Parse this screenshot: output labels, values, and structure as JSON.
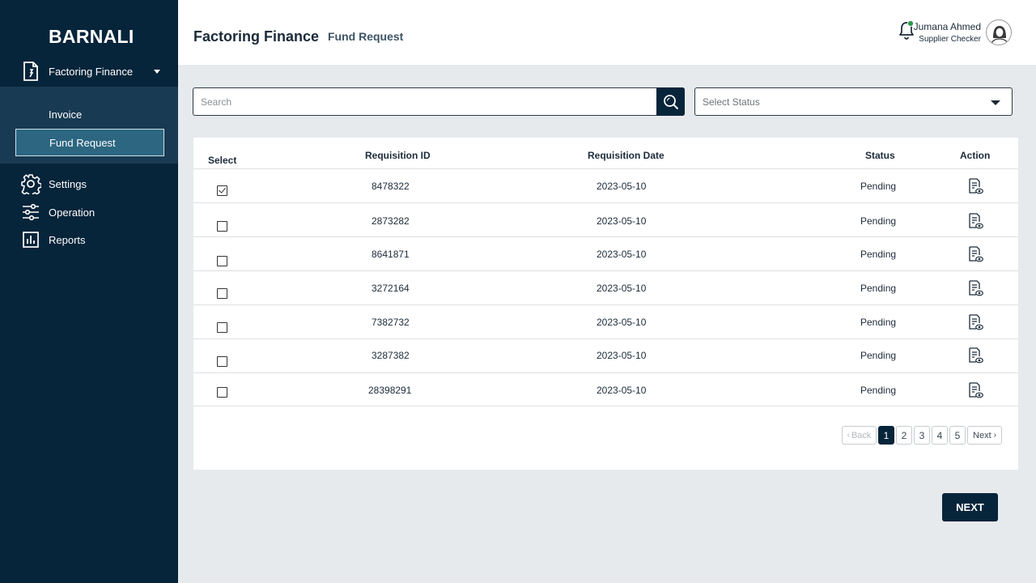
{
  "sidebar": {
    "brand": "BARNALI",
    "menu": {
      "label": "Factoring Finance",
      "icon": "document-icon"
    },
    "sub_items": [
      {
        "label": "Invoice"
      },
      {
        "label": "Fund Request"
      }
    ],
    "items": [
      {
        "label": "Settings",
        "icon": "gear-icon"
      },
      {
        "label": "Operation",
        "icon": "sliders-icon"
      },
      {
        "label": "Reports",
        "icon": "bar-chart-icon"
      }
    ]
  },
  "header": {
    "title": "Factoring Finance",
    "subtitle": "Fund Request",
    "user": {
      "name": "Jumana Ahmed",
      "role": "Supplier Checker"
    }
  },
  "search": {
    "placeholder": "Search"
  },
  "status_filter": {
    "placeholder": "Select Status"
  },
  "table": {
    "headers": {
      "select": "Select",
      "id": "Requisition ID",
      "date": "Requisition Date",
      "status": "Status",
      "action": "Action"
    },
    "rows": [
      {
        "id": "8478322",
        "date": "2023-05-10",
        "status": "Pending",
        "checked": true
      },
      {
        "id": "2873282",
        "date": "2023-05-10",
        "status": "Pending",
        "checked": false
      },
      {
        "id": "8641871",
        "date": "2023-05-10",
        "status": "Pending",
        "checked": false
      },
      {
        "id": "3272164",
        "date": "2023-05-10",
        "status": "Pending",
        "checked": false
      },
      {
        "id": "7382732",
        "date": "2023-05-10",
        "status": "Pending",
        "checked": false
      },
      {
        "id": "3287382",
        "date": "2023-05-10",
        "status": "Pending",
        "checked": false
      },
      {
        "id": "28398291",
        "date": "2023-05-10",
        "status": "Pending",
        "checked": false
      }
    ]
  },
  "pagination": {
    "back": "Back",
    "next": "Next",
    "pages": [
      "1",
      "2",
      "3",
      "4",
      "5"
    ],
    "current": "1"
  },
  "next_button": "NEXT",
  "colors": {
    "sidebar": "#06243a",
    "active_item": "#2c6680",
    "notification_dot": "#2e9a4a"
  }
}
